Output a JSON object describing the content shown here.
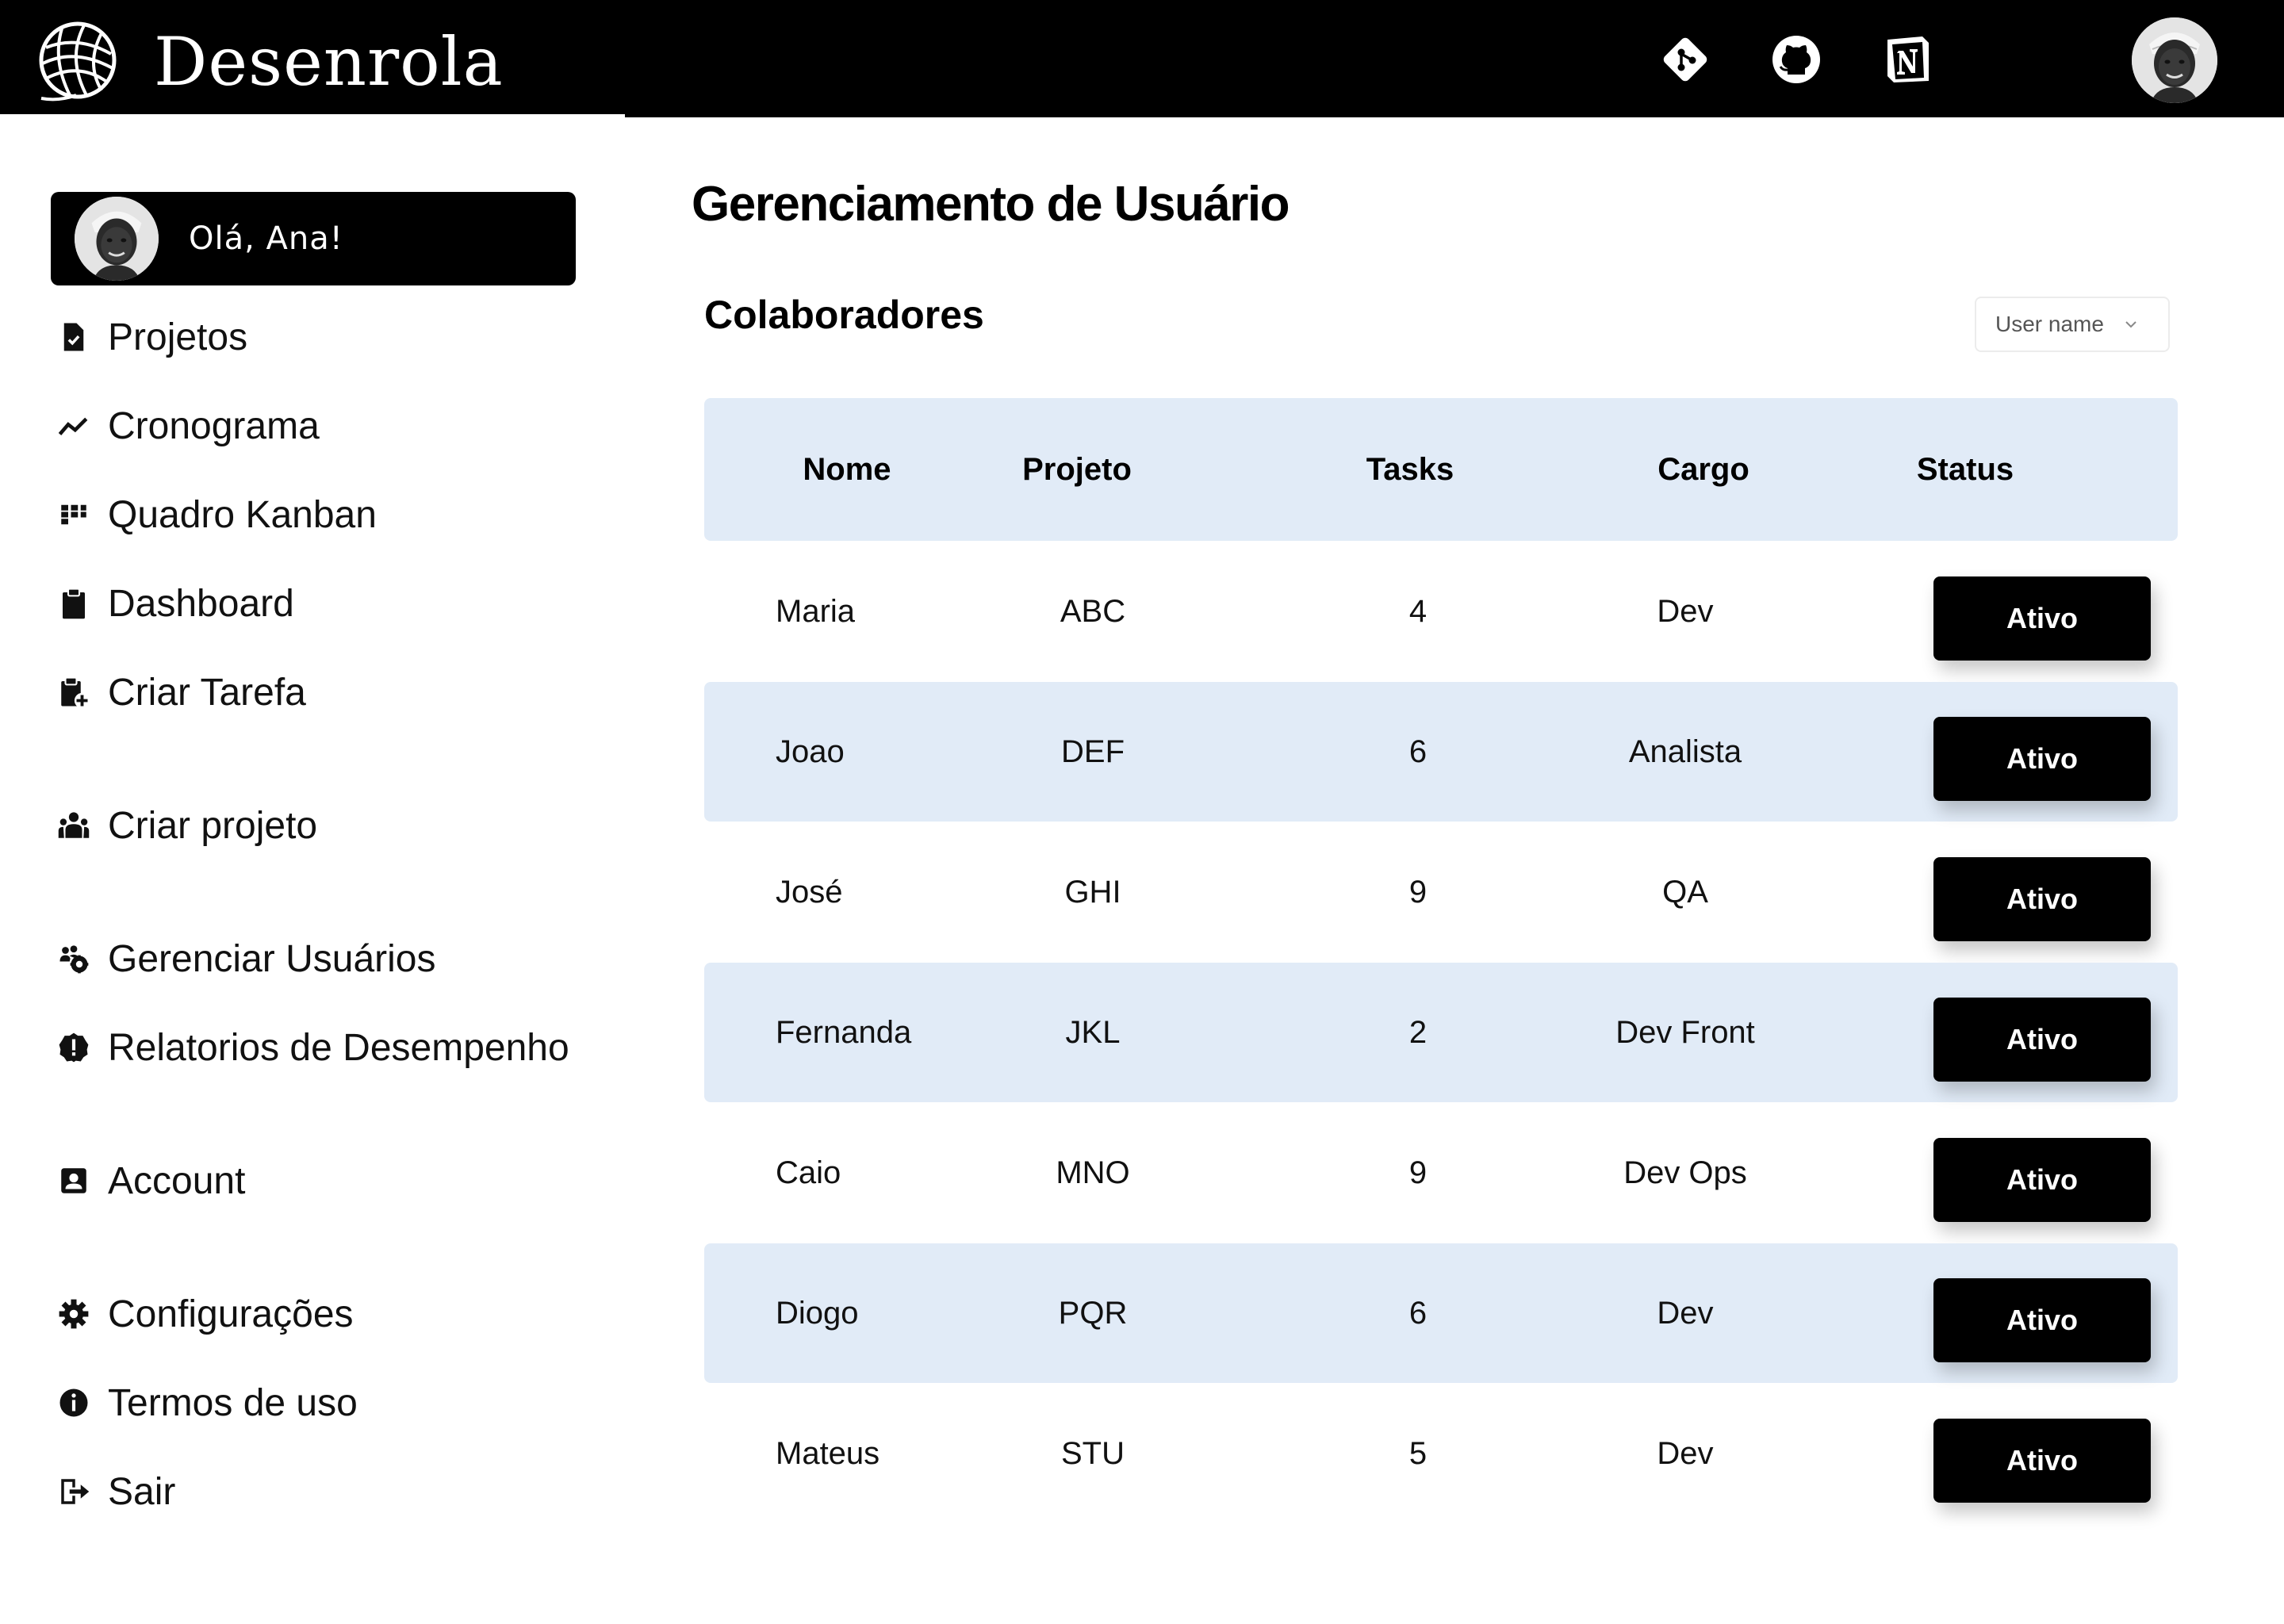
{
  "app": {
    "name": "Desenrola"
  },
  "topbar": {
    "icons": [
      "git-icon",
      "github-icon",
      "notion-icon"
    ],
    "avatar": "user-avatar"
  },
  "sidebar": {
    "greeting": "Olá, Ana!",
    "items": [
      {
        "label": "Projetos",
        "icon": "file-check-icon"
      },
      {
        "label": "Cronograma",
        "icon": "trend-line-icon"
      },
      {
        "label": "Quadro Kanban",
        "icon": "kanban-icon"
      },
      {
        "label": "Dashboard",
        "icon": "clipboard-icon"
      },
      {
        "label": "Criar Tarefa",
        "icon": "clipboard-plus-icon"
      },
      {
        "label": "Criar projeto",
        "icon": "team-icon"
      },
      {
        "label": "Gerenciar Usuários",
        "icon": "users-gear-icon"
      },
      {
        "label": "Relatorios de Desempenho",
        "icon": "alert-badge-icon"
      },
      {
        "label": "Account",
        "icon": "account-box-icon"
      },
      {
        "label": "Configurações",
        "icon": "gear-icon"
      },
      {
        "label": "Termos de uso",
        "icon": "info-icon"
      },
      {
        "label": "Sair",
        "icon": "logout-icon"
      }
    ]
  },
  "main": {
    "title": "Gerenciamento de Usuário",
    "section_title": "Colaboradores",
    "filter": {
      "label": "User name"
    },
    "table": {
      "columns": [
        "Nome",
        "Projeto",
        "Tasks",
        "Cargo",
        "Status"
      ],
      "rows": [
        {
          "nome": "Maria",
          "projeto": "ABC",
          "tasks": "4",
          "cargo": "Dev",
          "status": "Ativo"
        },
        {
          "nome": "Joao",
          "projeto": "DEF",
          "tasks": "6",
          "cargo": "Analista",
          "status": "Ativo"
        },
        {
          "nome": "José",
          "projeto": "GHI",
          "tasks": "9",
          "cargo": "QA",
          "status": "Ativo"
        },
        {
          "nome": "Fernanda",
          "projeto": "JKL",
          "tasks": "2",
          "cargo": "Dev Front",
          "status": "Ativo"
        },
        {
          "nome": "Caio",
          "projeto": "MNO",
          "tasks": "9",
          "cargo": "Dev Ops",
          "status": "Ativo"
        },
        {
          "nome": "Diogo",
          "projeto": "PQR",
          "tasks": "6",
          "cargo": "Dev",
          "status": "Ativo"
        },
        {
          "nome": "Mateus",
          "projeto": "STU",
          "tasks": "5",
          "cargo": "Dev",
          "status": "Ativo"
        }
      ]
    }
  },
  "colors": {
    "topbar": "#000000",
    "row_alt": "#e1ebf7",
    "status_button": "#000000"
  }
}
